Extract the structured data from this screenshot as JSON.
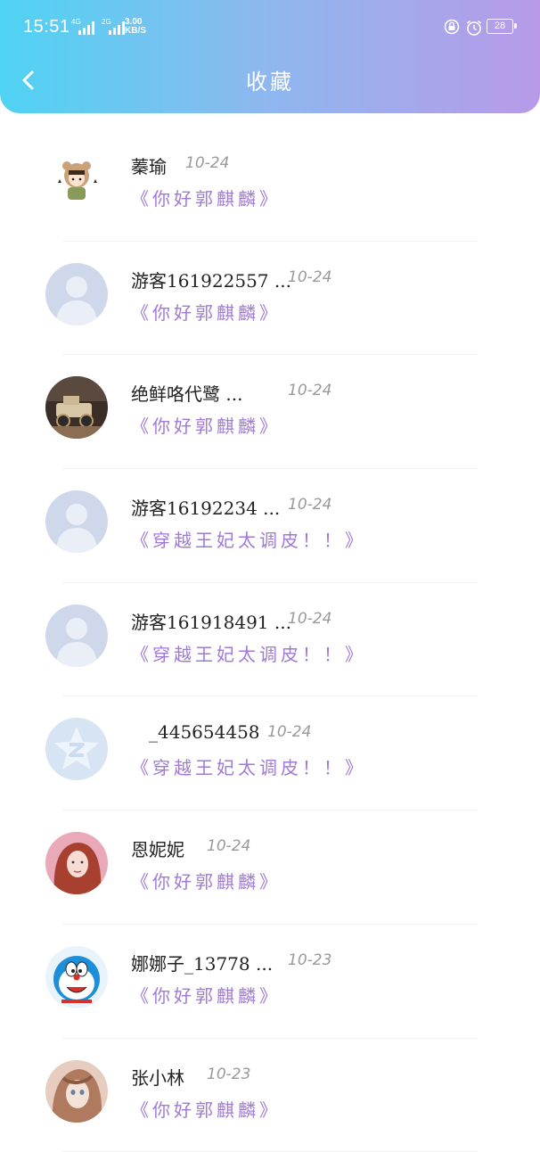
{
  "status_bar": {
    "time": "15:51",
    "signal1_label": "4G",
    "signal2_label": "2G",
    "speed_value": "3.00",
    "speed_unit": "KB/S",
    "battery": "28"
  },
  "header": {
    "title": "收藏"
  },
  "items": [
    {
      "name": "蓁瑜",
      "date": "10-24",
      "book": "《你好郭麒麟》",
      "avatar": "cartoon-girl-avatar"
    },
    {
      "name": "游客161922557 ...",
      "date": "10-24",
      "book": "《你好郭麒麟》",
      "avatar": "default-user-avatar"
    },
    {
      "name": "绝鲜咯代鹭 ...",
      "date": "10-24",
      "book": "《你好郭麒麟》",
      "avatar": "car-model-avatar"
    },
    {
      "name": "游客16192234 ...",
      "date": "10-24",
      "book": "《穿越王妃太调皮！！》",
      "avatar": "default-user-avatar"
    },
    {
      "name": "游客161918491 ...",
      "date": "10-24",
      "book": "《穿越王妃太调皮！！》",
      "avatar": "default-user-avatar"
    },
    {
      "name": "_445654458",
      "date": "10-24",
      "book": "《穿越王妃太调皮！！》",
      "avatar": "qq-avatar"
    },
    {
      "name": "恩妮妮",
      "date": "10-24",
      "book": "《你好郭麒麟》",
      "avatar": "woman-photo-avatar"
    },
    {
      "name": "娜娜子_13778 ...",
      "date": "10-23",
      "book": "《你好郭麒麟》",
      "avatar": "doraemon-avatar"
    },
    {
      "name": "张小林",
      "date": "10-23",
      "book": "《你好郭麒麟》",
      "avatar": "anime-girl-avatar"
    }
  ],
  "colors": {
    "header_start": "#4fd3f2",
    "header_end": "#b89ae8",
    "book_title": "#a07ad6",
    "date": "#9a9a9a"
  }
}
